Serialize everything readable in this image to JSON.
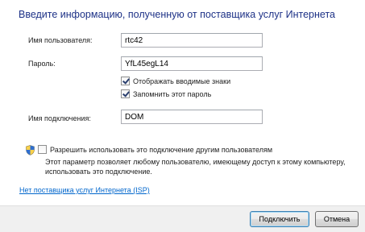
{
  "title": "Введите информацию, полученную от поставщика услуг Интернета",
  "username": {
    "label": "Имя пользователя:",
    "value": "rtc42"
  },
  "password": {
    "label": "Пароль:",
    "value": "YfL45egL14"
  },
  "show_chars": {
    "label": "Отображать вводимые знаки",
    "checked": true
  },
  "remember": {
    "label": "Запомнить этот пароль",
    "checked": true
  },
  "connection_name": {
    "label": "Имя подключения:",
    "value": "DOM"
  },
  "allow_others": {
    "label": "Разрешить использовать это подключение другим пользователям",
    "checked": false,
    "note": "Этот параметр позволяет любому пользователю, имеющему доступ к этому компьютеру, использовать это подключение."
  },
  "no_isp_link": "Нет поставщика услуг Интернета (ISP)",
  "buttons": {
    "connect": "Подключить",
    "cancel": "Отмена"
  },
  "icons": {
    "admin_shield": "uac-shield-icon"
  }
}
